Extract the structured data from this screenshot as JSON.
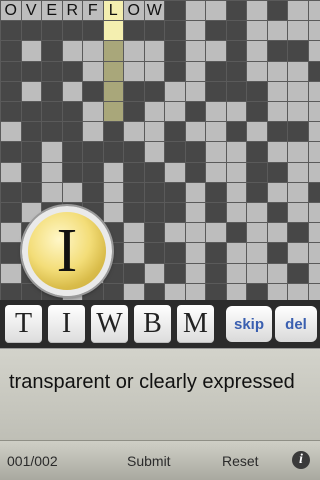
{
  "grid": {
    "cols": 16,
    "rows": 15,
    "top_word": [
      "O",
      "V",
      "E",
      "R",
      "F",
      "L",
      "O",
      "W"
    ]
  },
  "magnifier": {
    "letter": "I"
  },
  "tray": {
    "tiles": [
      "T",
      "I",
      "W",
      "B",
      "M"
    ],
    "skip_label": "skip",
    "del_label": "del"
  },
  "clue": {
    "text": "transparent or clearly expressed"
  },
  "bottom_bar": {
    "progress": "001/002",
    "submit_label": "Submit",
    "reset_label": "Reset",
    "info_glyph": "i"
  }
}
